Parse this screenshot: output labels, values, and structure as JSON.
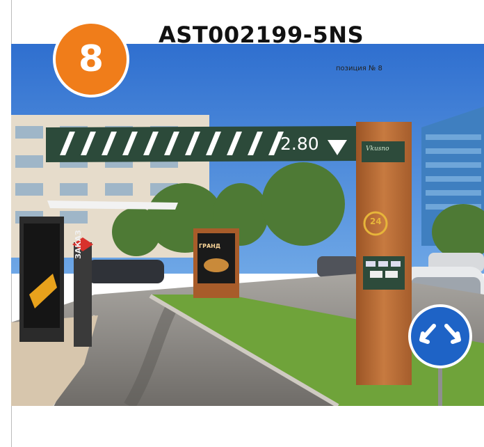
{
  "header": {
    "title": "AST002199-5NS",
    "position_label": "позиция № 8",
    "badge_number": "8",
    "badge_color": "#f07d1a"
  },
  "photo": {
    "clearance_sign": "2.80",
    "pylon_brand": "Vkusno",
    "pylon_badge": "24",
    "kiosk_vertical_text": "ЗАКАЗ",
    "menu_board_text": "ГРАНД",
    "sky_color": "#3a7ed6",
    "grass_color": "#6fa33a",
    "asphalt_color": "#8b8883",
    "pylon_color": "#b86a33"
  }
}
